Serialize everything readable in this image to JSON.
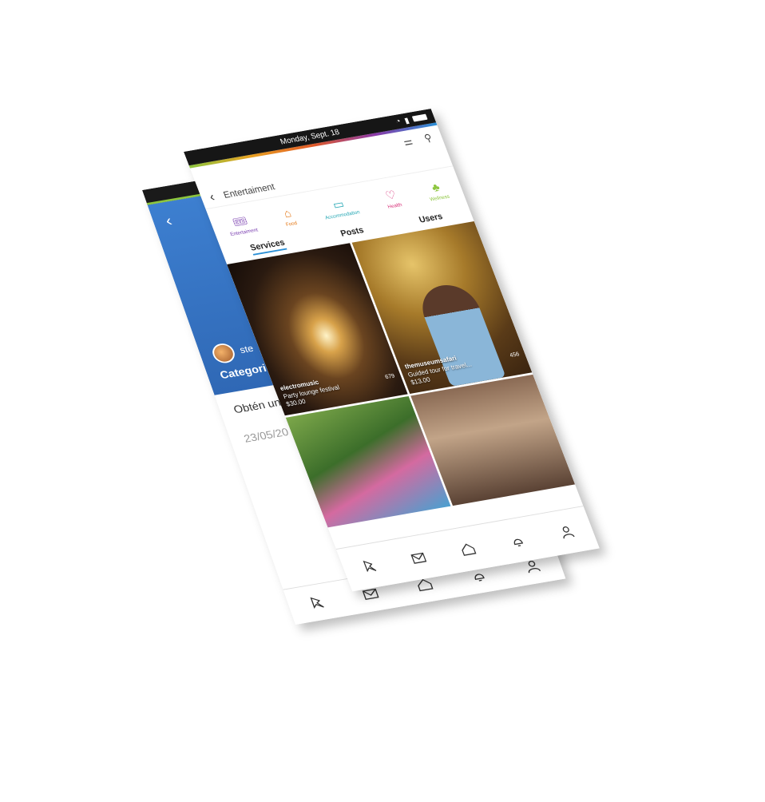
{
  "status": {
    "date": "Monday, Sept. 18"
  },
  "back_screen": {
    "user_name": "ste",
    "category_label": "Categori",
    "description": "Obtén un nuestras el mejor a",
    "date": "23/05/20"
  },
  "front_screen": {
    "page_title": "Entertaiment",
    "categories": [
      {
        "label": "Entertaiment",
        "icon": "ticket-icon",
        "color": "#7a3fb0"
      },
      {
        "label": "Food",
        "icon": "cloche-icon",
        "color": "#e57a1a"
      },
      {
        "label": "Accommodation",
        "icon": "bed-icon",
        "color": "#27a8b5"
      },
      {
        "label": "Health",
        "icon": "heart-icon",
        "color": "#d8327a"
      },
      {
        "label": "Wellness",
        "icon": "lotus-icon",
        "color": "#8dc63f"
      }
    ],
    "tabs": [
      {
        "label": "Services",
        "active": true
      },
      {
        "label": "Posts",
        "active": false
      },
      {
        "label": "Users",
        "active": false
      }
    ],
    "cards": [
      {
        "user": "electromusic",
        "title": "Party lounge festival",
        "price": "$30.00",
        "count": "679"
      },
      {
        "user": "themuseumsafari",
        "title": "Guided tour for travel...",
        "price": "$13.00",
        "count": "456"
      },
      {
        "user": "",
        "title": "",
        "price": "",
        "count": ""
      },
      {
        "user": "",
        "title": "",
        "price": "",
        "count": ""
      }
    ]
  },
  "nav": [
    "pin-icon",
    "mail-icon",
    "home-icon",
    "bell-icon",
    "user-icon"
  ]
}
